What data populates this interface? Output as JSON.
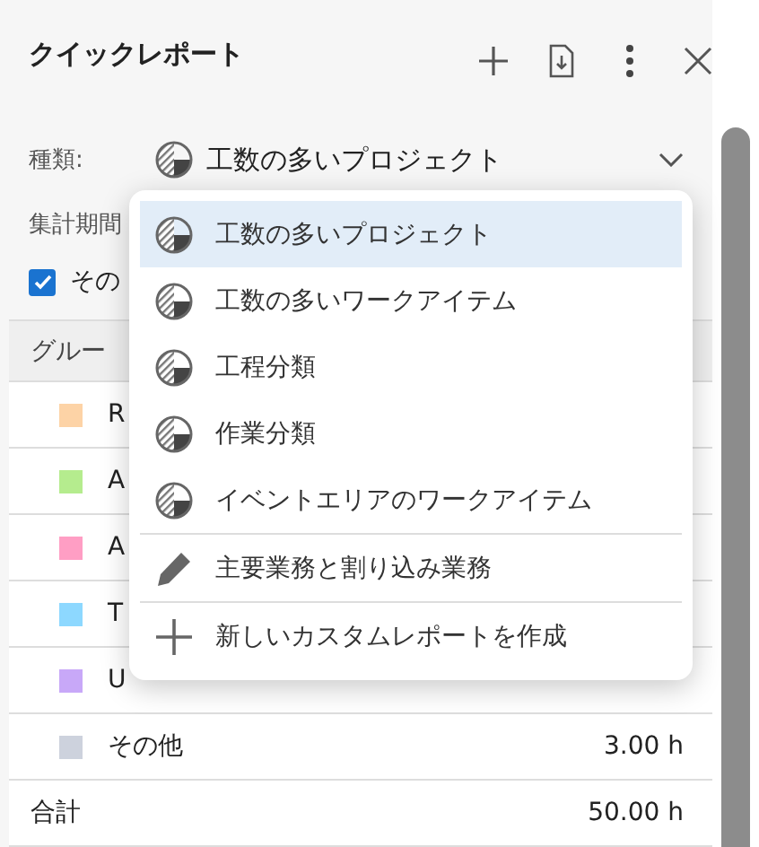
{
  "panel": {
    "title": "クイックレポート"
  },
  "type_field": {
    "label": "種類:",
    "value": "工数の多いプロジェクト"
  },
  "period": {
    "label": "集計期間"
  },
  "other_checkbox": {
    "label": "その",
    "checked": true
  },
  "table": {
    "columns": [
      "グルー"
    ],
    "rows": [
      {
        "label": "R",
        "color": "#fdd3a6"
      },
      {
        "label": "A",
        "color": "#b5ec8e"
      },
      {
        "label": "A",
        "color": "#ff9ec4"
      },
      {
        "label": "T",
        "color": "#8dd8ff"
      },
      {
        "label": "U",
        "color": "#c8a8f8"
      },
      {
        "label": "その他",
        "color": "#cdd2dd",
        "value": "3.00 h"
      }
    ],
    "total": {
      "label": "合計",
      "value": "50.00 h"
    }
  },
  "menu": {
    "items": [
      {
        "kind": "report",
        "label": "工数の多いプロジェクト",
        "selected": true
      },
      {
        "kind": "report",
        "label": "工数の多いワークアイテム",
        "selected": false
      },
      {
        "kind": "report",
        "label": "工程分類",
        "selected": false
      },
      {
        "kind": "report",
        "label": "作業分類",
        "selected": false
      },
      {
        "kind": "report",
        "label": "イベントエリアのワークアイテム",
        "selected": false
      },
      {
        "kind": "edit",
        "label": "主要業務と割り込み業務",
        "selected": false
      },
      {
        "kind": "create",
        "label": "新しいカスタムレポートを作成",
        "selected": false
      }
    ]
  }
}
